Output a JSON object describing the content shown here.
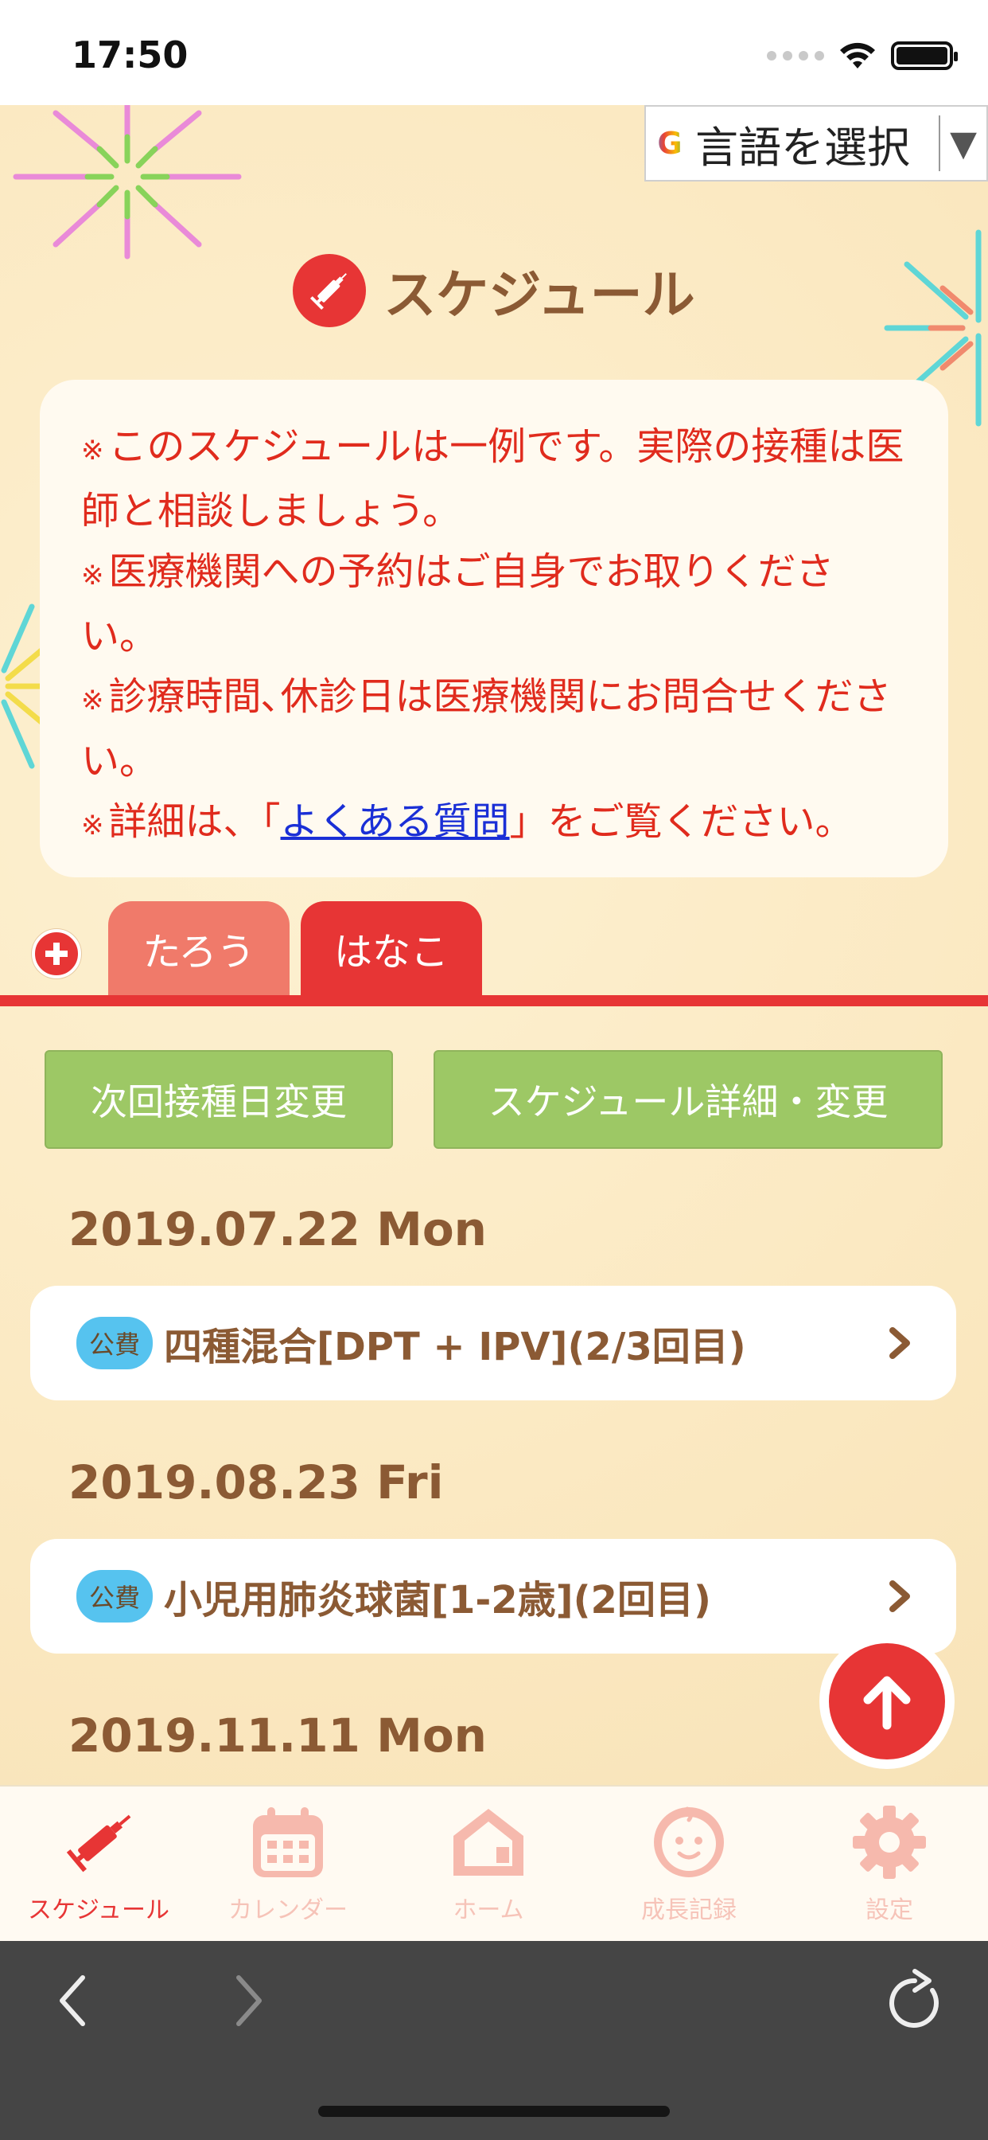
{
  "status": {
    "time": "17:50"
  },
  "language": {
    "label": "言語を選択",
    "g": "G",
    "arrow": "▼"
  },
  "page": {
    "title": "スケジュール"
  },
  "notice": {
    "mark": "※",
    "line1": "このスケジュールは一例です。実際の接種は医師と相談しましょう。",
    "line2": "医療機関への予約はご自身でお取りください。",
    "line3": "診療時間､休診日は医療機関にお問合せください。",
    "line4_pre": "詳細は、「",
    "line4_link": "よくある質問",
    "line4_post": "」をご覧ください。"
  },
  "tabs": [
    {
      "label": "たろう"
    },
    {
      "label": "はなこ"
    }
  ],
  "actions": {
    "next": "次回接種日変更",
    "detail": "スケジュール詳細・変更"
  },
  "schedule": [
    {
      "date": "2019.07.22 Mon",
      "badge": "公費",
      "name": "四種混合[DPT + IPV](2/3回目)"
    },
    {
      "date": "2019.08.23 Fri",
      "badge": "公費",
      "name": "小児用肺炎球菌[1-2歳](2回目)"
    },
    {
      "date": "2019.11.11 Mon"
    }
  ],
  "tabbar": [
    {
      "label": "スケジュール",
      "icon": "syringe-icon",
      "active": true
    },
    {
      "label": "カレンダー",
      "icon": "calendar-icon"
    },
    {
      "label": "ホーム",
      "icon": "home-icon"
    },
    {
      "label": "成長記録",
      "icon": "baby-face-icon"
    },
    {
      "label": "設定",
      "icon": "gear-icon"
    }
  ],
  "colors": {
    "accent": "#e73535",
    "green": "#9dc865",
    "brown": "#8b5a34",
    "badge": "#56c3ef"
  }
}
